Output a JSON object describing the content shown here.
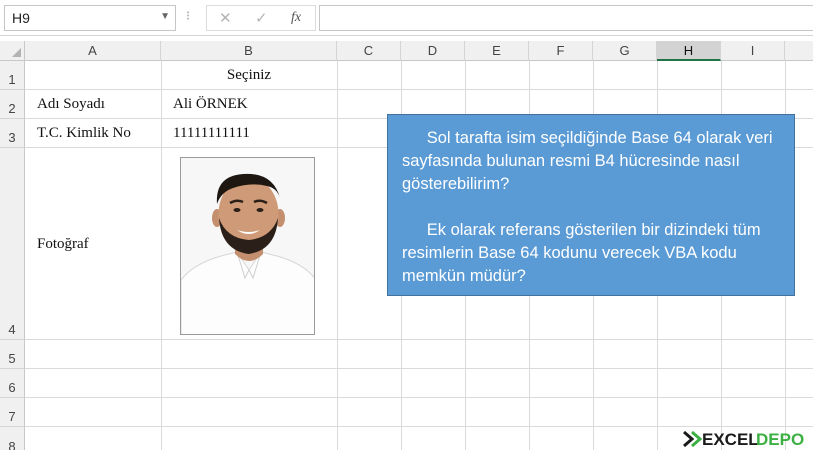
{
  "formula_bar": {
    "name_box": "H9",
    "separator": "⁝",
    "cancel_glyph": "✕",
    "enter_glyph": "✓",
    "fx_label": "fx",
    "formula": ""
  },
  "columns": [
    "A",
    "B",
    "C",
    "D",
    "E",
    "F",
    "G",
    "H",
    "I"
  ],
  "selected_column": "H",
  "rows": [
    "1",
    "2",
    "3",
    "4",
    "5",
    "6",
    "7",
    "8"
  ],
  "cells": {
    "B1": "Seçiniz",
    "A2": "Adı Soyadı",
    "B2": "Ali ÖRNEK",
    "A3": "T.C. Kimlik No",
    "B3": "11111111111",
    "A4": "Fotoğraf"
  },
  "callout": {
    "paragraph1": "Sol tarafta isim seçildiğinde Base 64  olarak veri sayfasında bulunan resmi B4 hücresinde nasıl gösterebilirim?",
    "paragraph2": "Ek olarak referans gösterilen bir dizindeki tüm resimlerin Base 64 kodunu verecek VBA kodu memkün müdür?"
  },
  "watermark": {
    "text_part1": "EXCEL",
    "text_part2": "DEPO"
  },
  "colors": {
    "callout_fill": "#5b9bd5",
    "callout_border": "#41719c",
    "selected_header_underline": "#217346",
    "logo_green": "#3cb043"
  },
  "icons": {
    "namebox_dropdown": "chevron-down-icon",
    "cancel": "close-icon",
    "enter": "check-icon",
    "insert_function": "function-icon",
    "photo": "person-photo"
  }
}
